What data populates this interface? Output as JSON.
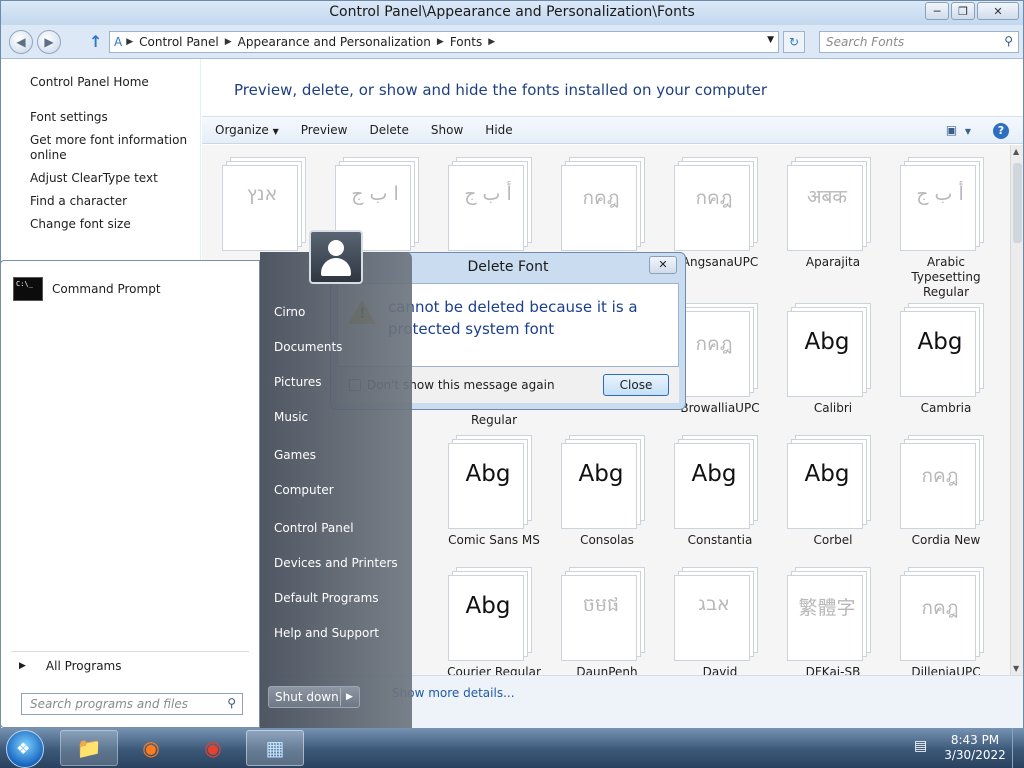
{
  "window": {
    "title": "Control Panel\\Appearance and Personalization\\Fonts",
    "minimize_icon": "minimize-icon",
    "maximize_icon": "restore-icon",
    "close_icon": "close-icon"
  },
  "address": {
    "crumbs": [
      "Control Panel",
      "Appearance and Personalization",
      "Fonts"
    ],
    "search_placeholder": "Search Fonts"
  },
  "nav": {
    "home": "Control Panel Home",
    "links": [
      "Font settings",
      "Get more font information online",
      "Adjust ClearType text",
      "Find a character",
      "Change font size"
    ]
  },
  "main": {
    "heading": "Preview, delete, or show and hide the fonts installed on your computer",
    "toolbar": [
      "Organize",
      "Preview",
      "Delete",
      "Show",
      "Hide"
    ],
    "show_more_details": "Show more details..."
  },
  "fonts": [
    {
      "glyph": "אנץ",
      "name": "",
      "ghost": true
    },
    {
      "glyph": "ا ب ج",
      "name": "",
      "ghost": true
    },
    {
      "glyph": "أ ب ج",
      "name": "",
      "ghost": true
    },
    {
      "glyph": "กคฎ",
      "name": "",
      "ghost": true
    },
    {
      "glyph": "กคฎ",
      "name": "AngsanaUPC",
      "ghost": true
    },
    {
      "glyph": "अबक",
      "name": "Aparajita",
      "ghost": true
    },
    {
      "glyph": "أ ب ج",
      "name": "Arabic Typesetting Regular",
      "ghost": true
    },
    {
      "glyph": "กคฎ",
      "name": "BrowalliaUPC",
      "ghost": true
    },
    {
      "glyph": "Abg",
      "name": "Calibri",
      "ghost": false
    },
    {
      "glyph": "Abg",
      "name": "Cambria",
      "ghost": false
    },
    {
      "glyph": "Abg",
      "name": "Comic Sans MS",
      "ghost": false
    },
    {
      "glyph": "Abg",
      "name": "Consolas",
      "ghost": false
    },
    {
      "glyph": "Abg",
      "name": "Constantia",
      "ghost": false
    },
    {
      "glyph": "Abg",
      "name": "Corbel",
      "ghost": false
    },
    {
      "glyph": "กคฎ",
      "name": "Cordia New",
      "ghost": true
    },
    {
      "glyph": "Abg",
      "name": "Courier Regular",
      "ghost": false
    },
    {
      "glyph": "ចមផ",
      "name": "DaunPenh",
      "ghost": true
    },
    {
      "glyph": "אבג",
      "name": "David",
      "ghost": true
    },
    {
      "glyph": "繁體字",
      "name": "DFKai-SB Regular",
      "ghost": true
    },
    {
      "glyph": "กคฎ",
      "name": "DilleniaUPC",
      "ghost": true
    }
  ],
  "partial_label": "Regular",
  "dialog": {
    "title": "Delete Font",
    "message": "cannot be deleted because it is a protected system font",
    "checkbox_label": "Don't show this message again",
    "close_label": "Close"
  },
  "start_menu": {
    "pinned": "Command Prompt",
    "all_programs": "All Programs",
    "search_placeholder": "Search programs and files",
    "right_items": [
      "Cirno",
      "Documents",
      "Pictures",
      "Music",
      "Games",
      "Computer",
      "Control Panel",
      "Devices and Printers",
      "Default Programs",
      "Help and Support"
    ],
    "shutdown": "Shut down"
  },
  "taskbar": {
    "time": "8:43 PM",
    "date": "3/30/2022"
  }
}
